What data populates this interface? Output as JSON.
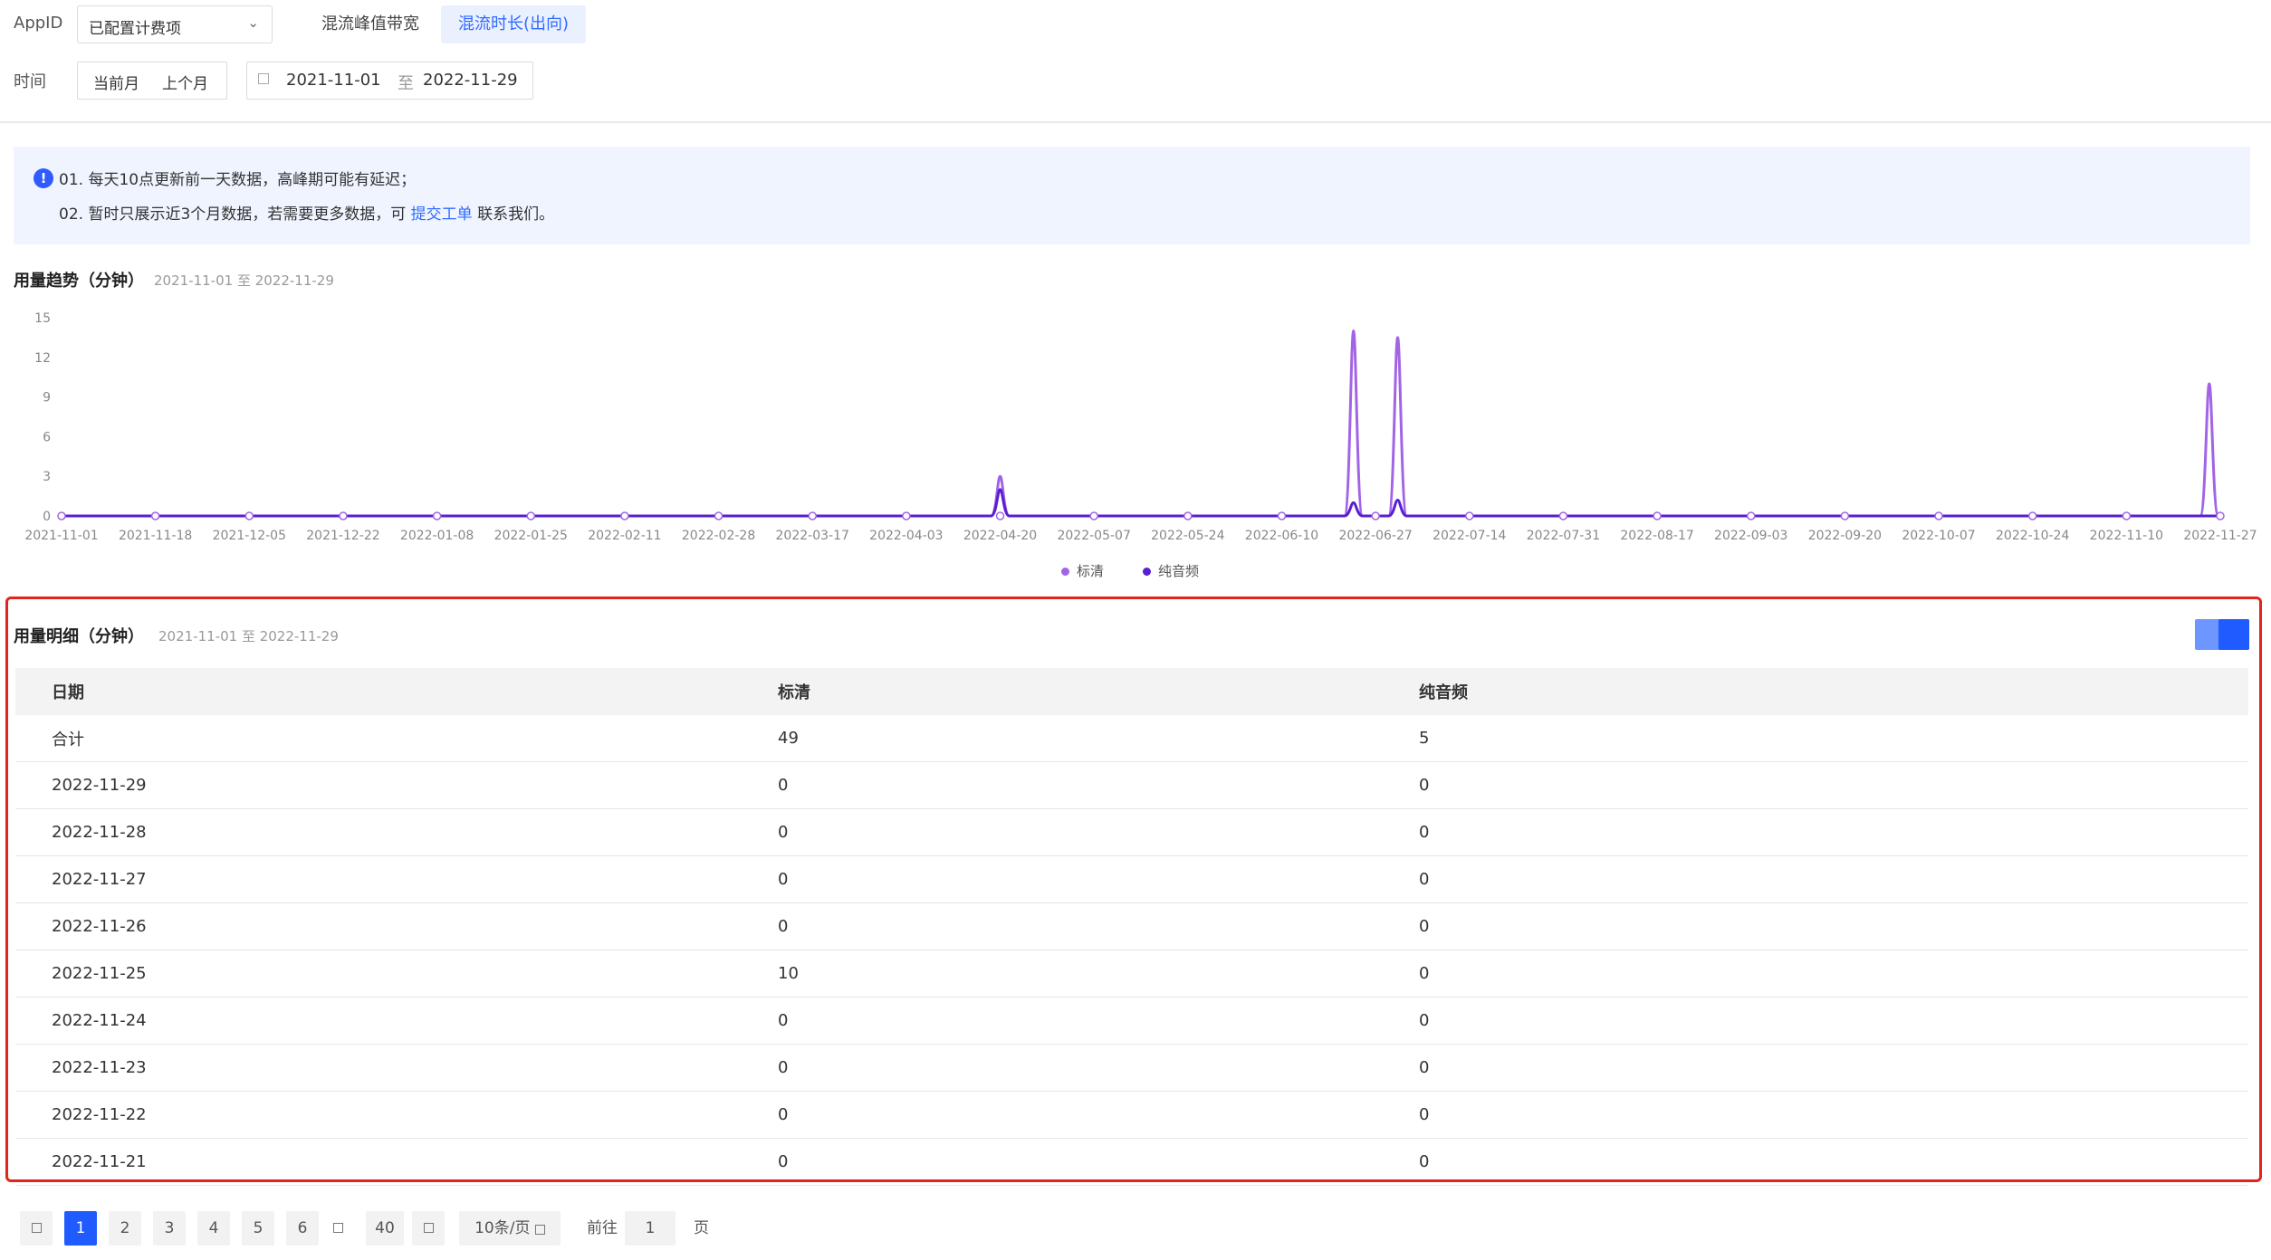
{
  "filters": {
    "appid_label": "AppID",
    "appid_value": "已配置计费项",
    "tabs": [
      {
        "label": "混流峰值带宽"
      },
      {
        "label": "混流时长(出向)"
      }
    ],
    "time_label": "时间",
    "quick": [
      "当前月",
      "上个月"
    ],
    "date_start": "2021-11-01",
    "date_sep": "至",
    "date_end": "2022-11-29"
  },
  "notice": {
    "icon": "!",
    "line1": "01. 每天10点更新前一天数据，高峰期可能有延迟；",
    "line2_prefix": "02. 暂时只展示近3个月数据，若需要更多数据，可",
    "line2_link": "提交工单",
    "line2_suffix": "联系我们。"
  },
  "trend": {
    "title": "用量趋势（分钟）",
    "range": "2021-11-01 至 2022-11-29"
  },
  "chart_data": {
    "type": "line",
    "x": [
      "2021-11-01",
      "2021-11-18",
      "2021-12-05",
      "2021-12-22",
      "2022-01-08",
      "2022-01-25",
      "2022-02-11",
      "2022-02-28",
      "2022-03-17",
      "2022-04-03",
      "2022-04-20",
      "2022-05-07",
      "2022-05-24",
      "2022-06-10",
      "2022-06-27",
      "2022-07-14",
      "2022-07-31",
      "2022-08-17",
      "2022-09-03",
      "2022-09-20",
      "2022-10-07",
      "2022-10-24",
      "2022-11-10",
      "2022-11-27"
    ],
    "ylim": [
      0,
      15
    ],
    "yticks": [
      0,
      3,
      6,
      9,
      12,
      15
    ],
    "grid": false,
    "legend": "bottom",
    "series": [
      {
        "name": "标清",
        "color": "#a264e6",
        "peaks": [
          {
            "date": "2022-04-20",
            "value": 3
          },
          {
            "date": "2022-06-23",
            "value": 14
          },
          {
            "date": "2022-07-01",
            "value": 13.5
          },
          {
            "date": "2022-11-25",
            "value": 10
          }
        ]
      },
      {
        "name": "纯音频",
        "color": "#5a1fd1",
        "peaks": [
          {
            "date": "2022-04-20",
            "value": 2
          },
          {
            "date": "2022-06-23",
            "value": 1
          },
          {
            "date": "2022-07-01",
            "value": 1.2
          }
        ]
      }
    ]
  },
  "detail": {
    "title": "用量明细（分钟）",
    "range": "2021-11-01 至 2022-11-29",
    "columns": [
      "日期",
      "标清",
      "纯音频"
    ],
    "rows": [
      [
        "合计",
        "49",
        "5"
      ],
      [
        "2022-11-29",
        "0",
        "0"
      ],
      [
        "2022-11-28",
        "0",
        "0"
      ],
      [
        "2022-11-27",
        "0",
        "0"
      ],
      [
        "2022-11-26",
        "0",
        "0"
      ],
      [
        "2022-11-25",
        "10",
        "0"
      ],
      [
        "2022-11-24",
        "0",
        "0"
      ],
      [
        "2022-11-23",
        "0",
        "0"
      ],
      [
        "2022-11-22",
        "0",
        "0"
      ],
      [
        "2022-11-21",
        "0",
        "0"
      ]
    ]
  },
  "pager": {
    "pages": [
      "1",
      "2",
      "3",
      "4",
      "5",
      "6"
    ],
    "last": "40",
    "page_size": "10条/页",
    "goto_label": "前往",
    "goto_value": "1",
    "goto_suffix": "页"
  }
}
